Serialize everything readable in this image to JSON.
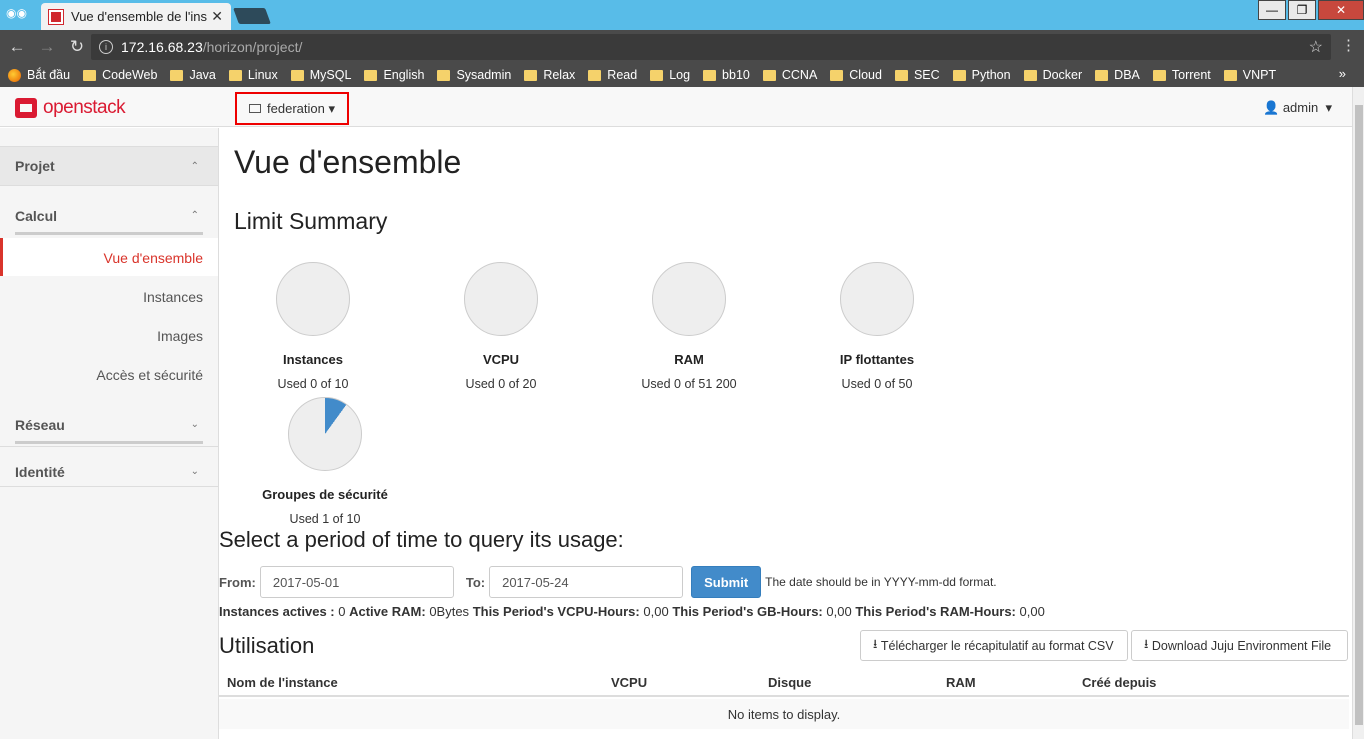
{
  "browser": {
    "tab_title": "Vue d'ensemble de l'insta",
    "url_host": "172.16.68.23",
    "url_path": "/horizon/project/",
    "bookmarks": [
      {
        "label": "Bắt đầu",
        "icon": "firefox-icon"
      },
      {
        "label": "CodeWeb",
        "icon": "folder-icon"
      },
      {
        "label": "Java",
        "icon": "folder-icon"
      },
      {
        "label": "Linux",
        "icon": "folder-icon"
      },
      {
        "label": "MySQL",
        "icon": "folder-icon"
      },
      {
        "label": "English",
        "icon": "folder-icon"
      },
      {
        "label": "Sysadmin",
        "icon": "folder-icon"
      },
      {
        "label": "Relax",
        "icon": "folder-icon"
      },
      {
        "label": "Read",
        "icon": "folder-icon"
      },
      {
        "label": "Log",
        "icon": "folder-icon"
      },
      {
        "label": "bb10",
        "icon": "folder-icon"
      },
      {
        "label": "CCNA",
        "icon": "folder-icon"
      },
      {
        "label": "Cloud",
        "icon": "folder-icon"
      },
      {
        "label": "SEC",
        "icon": "folder-icon"
      },
      {
        "label": "Python",
        "icon": "folder-icon"
      },
      {
        "label": "Docker",
        "icon": "folder-icon"
      },
      {
        "label": "DBA",
        "icon": "folder-icon"
      },
      {
        "label": "Torrent",
        "icon": "folder-icon"
      },
      {
        "label": "VNPT",
        "icon": "folder-icon"
      }
    ]
  },
  "header": {
    "logo": "openstack",
    "project": "federation",
    "user": "admin"
  },
  "sidebar": {
    "project": "Projet",
    "compute": "Calcul",
    "items": [
      "Vue d'ensemble",
      "Instances",
      "Images",
      "Accès et sécurité"
    ],
    "network": "Réseau",
    "identity": "Identité"
  },
  "main": {
    "title": "Vue d'ensemble",
    "limit_summary": "Limit Summary",
    "pies": [
      {
        "label": "Instances",
        "used": "Used 0 of 10",
        "fraction": 0
      },
      {
        "label": "VCPU",
        "used": "Used 0 of 20",
        "fraction": 0
      },
      {
        "label": "RAM",
        "used": "Used 0 of 51 200",
        "fraction": 0
      },
      {
        "label": "IP flottantes",
        "used": "Used 0 of 50",
        "fraction": 0
      },
      {
        "label": "Groupes de sécurité",
        "used": "Used 1 of 10",
        "fraction": 0.1
      }
    ],
    "select_period": "Select a period of time to query its usage:",
    "from_label": "From:",
    "from_value": "2017-05-01",
    "to_label": "To:",
    "to_value": "2017-05-24",
    "submit": "Submit",
    "hint": "The date should be in YYYY-mm-dd format.",
    "stats": [
      {
        "k": "Instances actives :",
        "v": "0"
      },
      {
        "k": "Active RAM:",
        "v": "0Bytes"
      },
      {
        "k": "This Period's VCPU-Hours:",
        "v": "0,00"
      },
      {
        "k": "This Period's GB-Hours:",
        "v": "0,00"
      },
      {
        "k": "This Period's RAM-Hours:",
        "v": "0,00"
      }
    ],
    "usage_title": "Utilisation",
    "csv_button": "Télécharger le récapitulatif au format CSV",
    "juju_button": "Download Juju Environment File",
    "columns": [
      "Nom de l'instance",
      "VCPU",
      "Disque",
      "RAM",
      "Créé depuis"
    ],
    "empty": "No items to display."
  },
  "colors": {
    "accent": "#d9342b",
    "pie_fill": "#428bca",
    "submit": "#428bca"
  }
}
